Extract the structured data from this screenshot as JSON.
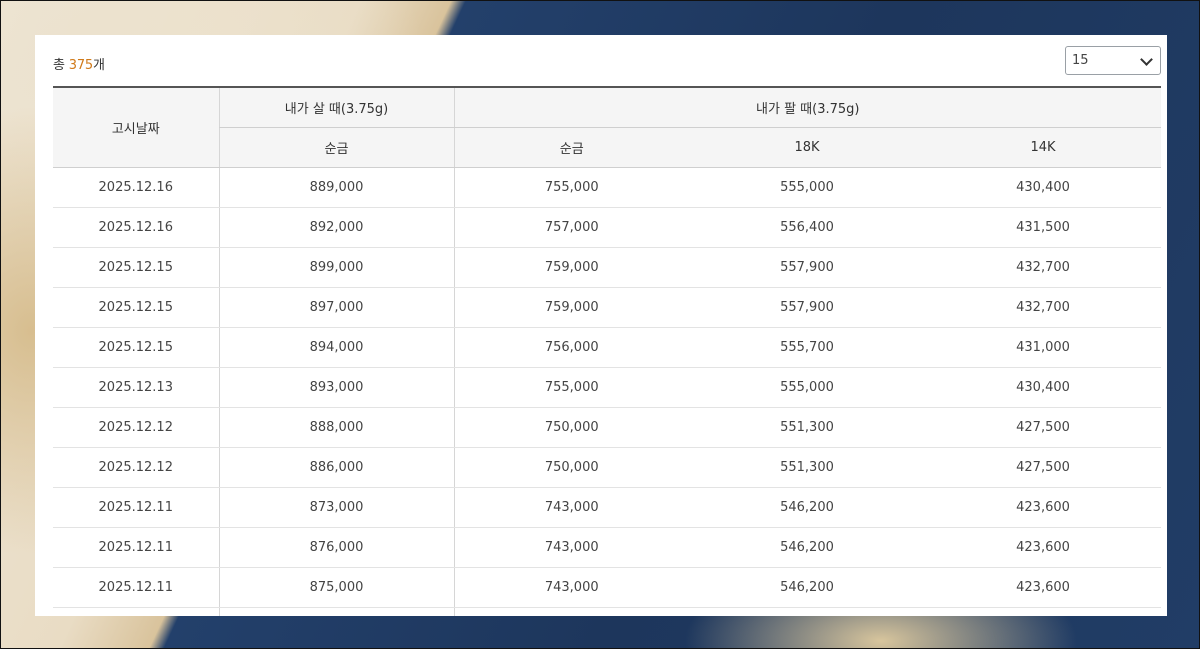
{
  "summary": {
    "prefix": "총",
    "count": "375",
    "suffix": "개"
  },
  "per_page": {
    "selected": "15"
  },
  "table": {
    "date_header": "고시날짜",
    "buy_group": "내가 살 때(3.75g)",
    "sell_group": "내가 팔 때(3.75g)",
    "buy_col": "순금",
    "sell_cols": [
      "순금",
      "18K",
      "14K"
    ],
    "rows": [
      [
        "2025.12.16",
        "889,000",
        "755,000",
        "555,000",
        "430,400"
      ],
      [
        "2025.12.16",
        "892,000",
        "757,000",
        "556,400",
        "431,500"
      ],
      [
        "2025.12.15",
        "899,000",
        "759,000",
        "557,900",
        "432,700"
      ],
      [
        "2025.12.15",
        "897,000",
        "759,000",
        "557,900",
        "432,700"
      ],
      [
        "2025.12.15",
        "894,000",
        "756,000",
        "555,700",
        "431,000"
      ],
      [
        "2025.12.13",
        "893,000",
        "755,000",
        "555,000",
        "430,400"
      ],
      [
        "2025.12.12",
        "888,000",
        "750,000",
        "551,300",
        "427,500"
      ],
      [
        "2025.12.12",
        "886,000",
        "750,000",
        "551,300",
        "427,500"
      ],
      [
        "2025.12.11",
        "873,000",
        "743,000",
        "546,200",
        "423,600"
      ],
      [
        "2025.12.11",
        "876,000",
        "743,000",
        "546,200",
        "423,600"
      ],
      [
        "2025.12.11",
        "875,000",
        "743,000",
        "546,200",
        "423,600"
      ],
      [
        "",
        "",
        "",
        "",
        ""
      ]
    ]
  },
  "colors": {
    "accent": "#d07a1a",
    "header_bg": "#f5f5f5",
    "background": "#1f3a63"
  }
}
